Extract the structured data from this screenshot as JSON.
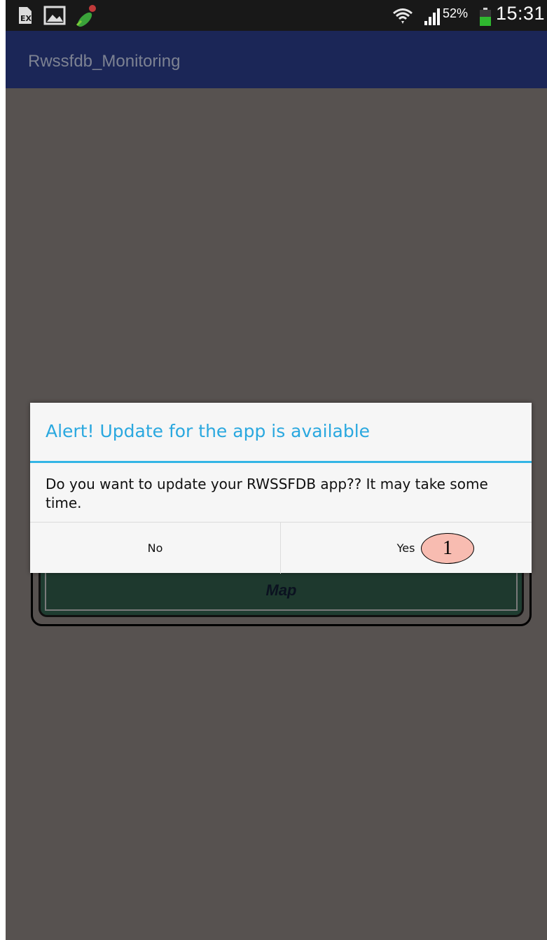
{
  "status_bar": {
    "battery_percent": "52%",
    "time": "15:31",
    "notification_icons": [
      "sim-alert-icon",
      "gallery-icon",
      "fake-gps-icon"
    ],
    "system_icons": [
      "wifi-icon",
      "signal-icon",
      "battery-icon"
    ],
    "battery_color": "#2fb82f"
  },
  "app_bar": {
    "title": "Rwssfdb_Monitoring",
    "color": "#1b2657"
  },
  "background_screen": {
    "map_button_label": "Map"
  },
  "dialog": {
    "title": "Alert! Update for the app is available",
    "message": "Do you want to update your RWSSFDB app?? It may take some time.",
    "negative_button": "No",
    "positive_button": "Yes",
    "accent_color": "#33b5e5"
  },
  "annotation": {
    "step_number": "1"
  }
}
